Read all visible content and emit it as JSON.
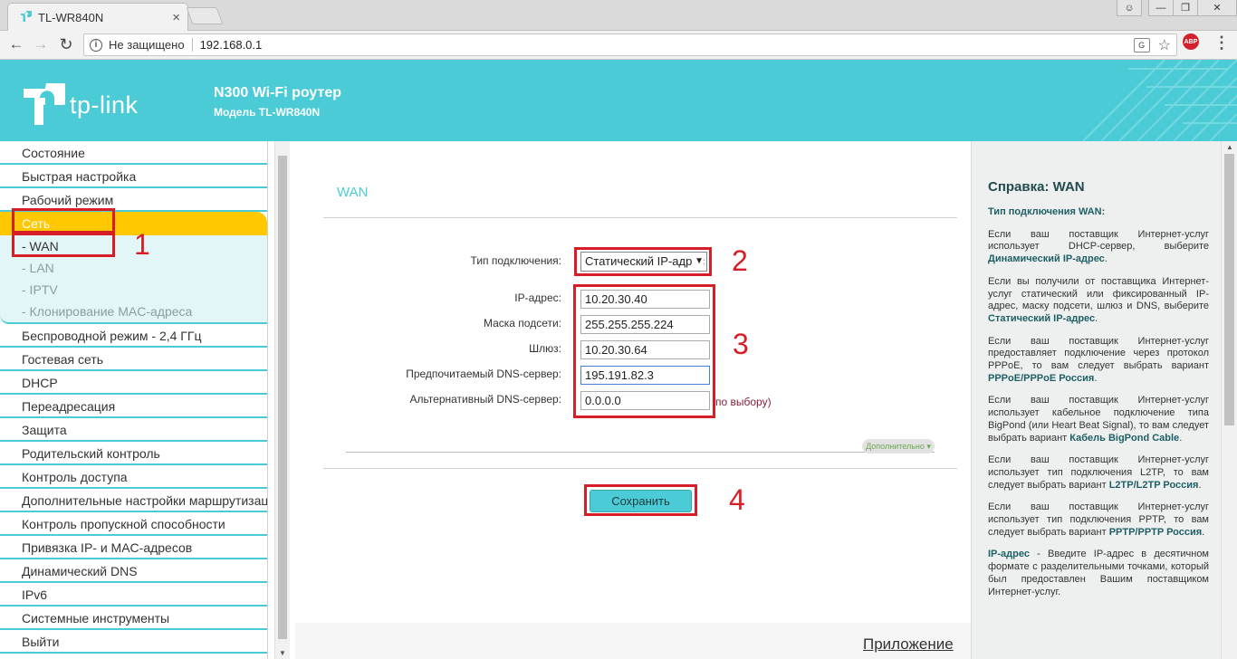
{
  "browser": {
    "tab_title": "TL-WR840N",
    "tab_close": "×",
    "address_security": "Не защищено",
    "address_url": "192.168.0.1",
    "icons": [
      "back-icon",
      "forward-icon",
      "reload-icon",
      "info-icon",
      "translate-icon",
      "star-icon",
      "adblock-icon",
      "menu-icon",
      "user-icon",
      "minimize-icon",
      "restore-icon",
      "close-icon"
    ],
    "abp": "ABP"
  },
  "header": {
    "logo_text": "tp-link",
    "model_title": "N300 Wi-Fi роутер",
    "model_sub": "Модель TL-WR840N",
    "background": "#4acbd6"
  },
  "sidebar": {
    "items_top": [
      "Состояние",
      "Быстрая настройка",
      "Рабочий режим"
    ],
    "active": "Сеть",
    "sub_items": [
      "- WAN",
      "- LAN",
      "- IPTV",
      "- Клонирование MAC-адреса"
    ],
    "items_bottom": [
      "Беспроводной режим - 2,4 ГГц",
      "Гостевая сеть",
      "DHCP",
      "Переадресация",
      "Защита",
      "Родительский контроль",
      "Контроль доступа",
      "Дополнительные настройки маршрутизации",
      "Контроль пропускной способности",
      "Привязка IP- и MAC-адресов",
      "Динамический DNS",
      "IPv6",
      "Системные инструменты",
      "Выйти"
    ]
  },
  "main": {
    "title": "WAN",
    "connection_type_label": "Тип подключения:",
    "connection_type_value": "Статический IP-адрес",
    "ip_label": "IP-адрес:",
    "ip_value": "10.20.30.40",
    "mask_label": "Маска подсети:",
    "mask_value": "255.255.255.224",
    "gateway_label": "Шлюз:",
    "gateway_value": "10.20.30.64",
    "dns1_label": "Предпочитаемый DNS-сервер:",
    "dns1_value": "195.191.82.3",
    "dns2_label": "Альтернативный DNS-сервер:",
    "dns2_value": "0.0.0.0",
    "dns2_note": "по выбору)",
    "advanced": "Дополнительно",
    "save": "Сохранить",
    "app_link": "Приложение"
  },
  "annotations": [
    "1",
    "2",
    "3",
    "4"
  ],
  "annotation_color": "#d71e26",
  "help": {
    "title": "Справка: WAN",
    "subtitle": "Тип подключения WAN:",
    "p1": "Если ваш поставщик Интернет-услуг использует DHCP-сервер, выберите",
    "p1_hl": "Динамический IP-адрес",
    "p2": "Если вы получили от поставщика Интернет-услуг статический или фиксированный IP-адрес, маску подсети, шлюз и DNS, выберите",
    "p2_hl": "Статический IP-адрес",
    "p3": "Если ваш поставщик Интернет-услуг предоставляет подключение через протокол PPPoE, то вам следует выбрать вариант",
    "p3_hl": "PPPoE/PPPoE Россия",
    "p4": "Если ваш поставщик Интернет-услуг использует кабельное подключение типа BigPond (или Heart Beat Signal), то вам следует выбрать вариант",
    "p4_hl": "Кабель BigPond Cable",
    "p5": "Если ваш поставщик Интернет-услуг использует тип подключения L2TP, то вам следует выбрать вариант",
    "p5_hl": "L2TP/L2TP Россия",
    "p6": "Если ваш поставщик Интернет-услуг использует тип подключения PPTP, то вам следует выбрать вариант",
    "p6_hl": "PPTP/PPTP Россия",
    "p7_hl": "IP-адрес",
    "p7": "- Введите IP-адрес в десятичном формате с разделительными точками, который был предоставлен Вашим поставщиком Интернет-услуг."
  }
}
